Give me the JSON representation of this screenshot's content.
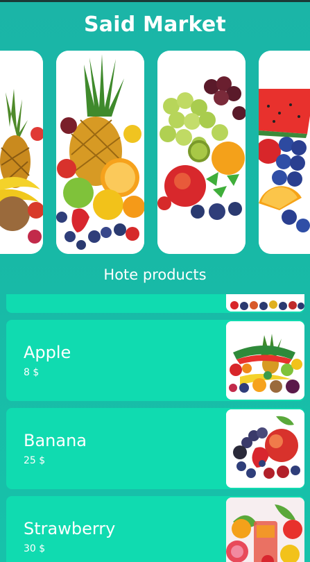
{
  "app": {
    "title": "Said Market"
  },
  "carousel": {
    "images": [
      "tropical-fruit-image",
      "pineapple-fruit-image",
      "grapes-fruit-image",
      "watermelon-berries-image"
    ]
  },
  "hot_products": {
    "title": "Hote products",
    "items": [
      {
        "name": "Apple",
        "price": "8 $",
        "image": "mixed-fruit-image"
      },
      {
        "name": "Banana",
        "price": "25 $",
        "image": "apple-berries-image"
      },
      {
        "name": "Strawberry",
        "price": "30 $",
        "image": "fruit-juice-image"
      }
    ]
  },
  "colors": {
    "background": "#18b8a6",
    "card": "#10dbb0",
    "text": "#ffffff"
  }
}
